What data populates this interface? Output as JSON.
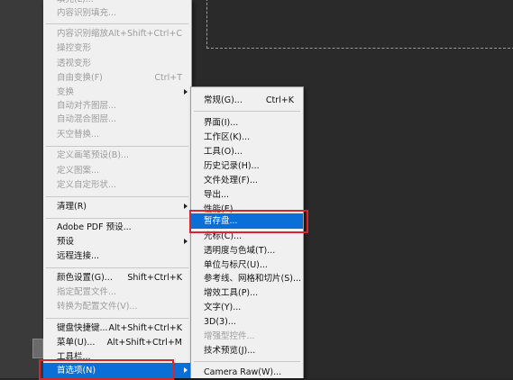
{
  "edit_menu": {
    "items": [
      {
        "label": "填充(L)...",
        "disabled": true
      },
      {
        "label": "内容识别填充...",
        "disabled": true
      },
      {
        "label": "内容识别缩放",
        "shortcut": "Alt+Shift+Ctrl+C",
        "disabled": true
      },
      {
        "label": "操控变形",
        "disabled": true
      },
      {
        "label": "透视变形",
        "disabled": true
      },
      {
        "label": "自由变换(F)",
        "shortcut": "Ctrl+T",
        "disabled": true
      },
      {
        "label": "变换",
        "disabled": true,
        "submenu": true
      },
      {
        "label": "自动对齐图层...",
        "disabled": true
      },
      {
        "label": "自动混合图层...",
        "disabled": true
      },
      {
        "label": "天空替换...",
        "disabled": true
      },
      {
        "label": "定义画笔预设(B)...",
        "disabled": true
      },
      {
        "label": "定义图案...",
        "disabled": true
      },
      {
        "label": "定义自定形状...",
        "disabled": true
      },
      {
        "label": "清理(R)",
        "disabled": false,
        "submenu": true
      },
      {
        "label": "Adobe PDF 预设...",
        "disabled": false
      },
      {
        "label": "预设",
        "disabled": false,
        "submenu": true
      },
      {
        "label": "远程连接...",
        "disabled": false
      },
      {
        "label": "颜色设置(G)...",
        "shortcut": "Shift+Ctrl+K",
        "disabled": false
      },
      {
        "label": "指定配置文件...",
        "disabled": true
      },
      {
        "label": "转换为配置文件(V)...",
        "disabled": true
      },
      {
        "label": "键盘快捷键...",
        "shortcut": "Alt+Shift+Ctrl+K",
        "disabled": false
      },
      {
        "label": "菜单(U)...",
        "shortcut": "Alt+Shift+Ctrl+M",
        "disabled": false
      },
      {
        "label": "工具栏...",
        "disabled": false
      },
      {
        "label": "首选项(N)",
        "disabled": false,
        "submenu": true,
        "selected": true
      }
    ]
  },
  "preferences_submenu": {
    "items": [
      {
        "label": "常规(G)...",
        "shortcut": "Ctrl+K"
      },
      {
        "label": "界面(I)..."
      },
      {
        "label": "工作区(K)..."
      },
      {
        "label": "工具(O)..."
      },
      {
        "label": "历史记录(H)..."
      },
      {
        "label": "文件处理(F)..."
      },
      {
        "label": "导出..."
      },
      {
        "label": "性能(E)..."
      },
      {
        "label": "暂存盘...",
        "selected": true
      },
      {
        "label": "光标(C)..."
      },
      {
        "label": "透明度与色域(T)..."
      },
      {
        "label": "单位与标尺(U)..."
      },
      {
        "label": "参考线、网格和切片(S)..."
      },
      {
        "label": "增效工具(P)..."
      },
      {
        "label": "文字(Y)..."
      },
      {
        "label": "3D(3)..."
      },
      {
        "label": "增强型控件...",
        "disabled": true
      },
      {
        "label": "技术预览(J)..."
      },
      {
        "label": "Camera Raw(W)..."
      }
    ]
  },
  "colors": {
    "highlight": "#0a70d8",
    "annotation": "#d9262e"
  }
}
